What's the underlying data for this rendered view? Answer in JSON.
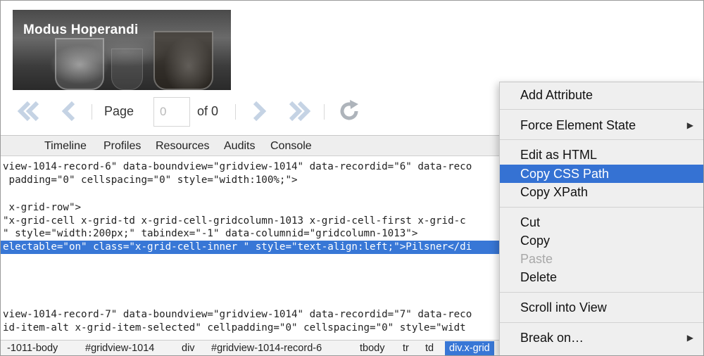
{
  "app": {
    "title": "Modus Hoperandi"
  },
  "pager": {
    "page_label": "Page",
    "page_value": "0",
    "of_label": "of 0",
    "icons": [
      "first-page-icon",
      "prev-page-icon",
      "next-page-icon",
      "last-page-icon",
      "refresh-icon"
    ]
  },
  "devtools": {
    "tabs": [
      "Timeline",
      "Profiles",
      "Resources",
      "Audits",
      "Console"
    ],
    "code_lines": [
      "view-1014-record-6\" data-boundview=\"gridview-1014\" data-recordid=\"6\" data-reco",
      " padding=\"0\" cellspacing=\"0\" style=\"width:100%;\">",
      "",
      " x-grid-row\">",
      "\"x-grid-cell x-grid-td x-grid-cell-gridcolumn-1013 x-grid-cell-first x-grid-c",
      "\" style=\"width:200px;\" tabindex=\"-1\" data-columnid=\"gridcolumn-1013\">",
      "electable=\"on\" class=\"x-grid-cell-inner \" style=\"text-align:left;\">Pilsner</di",
      "view-1014-record-7\" data-boundview=\"gridview-1014\" data-recordid=\"7\" data-reco",
      "id-item-alt x-grid-item-selected\" cellpadding=\"0\" cellspacing=\"0\" style=\"widt"
    ],
    "breadcrumb": [
      "-1011-body",
      "#gridview-1014",
      "div",
      "#gridview-1014-record-6",
      "tbody",
      "tr",
      "td",
      "div.x-grid"
    ]
  },
  "context_menu": {
    "items": [
      {
        "label": "Add Attribute",
        "state": "normal"
      },
      {
        "label": "Force Element State",
        "state": "submenu"
      },
      {
        "label": "Edit as HTML",
        "state": "normal"
      },
      {
        "label": "Copy CSS Path",
        "state": "highlighted"
      },
      {
        "label": "Copy XPath",
        "state": "normal"
      },
      {
        "label": "Cut",
        "state": "normal"
      },
      {
        "label": "Copy",
        "state": "normal"
      },
      {
        "label": "Paste",
        "state": "disabled"
      },
      {
        "label": "Delete",
        "state": "normal"
      },
      {
        "label": "Scroll into View",
        "state": "normal"
      },
      {
        "label": "Break on…",
        "state": "submenu"
      }
    ]
  },
  "colors": {
    "selection": "#3877d6",
    "menu_highlight": "#3572d3",
    "pager_icon": "#c5d3e4"
  }
}
